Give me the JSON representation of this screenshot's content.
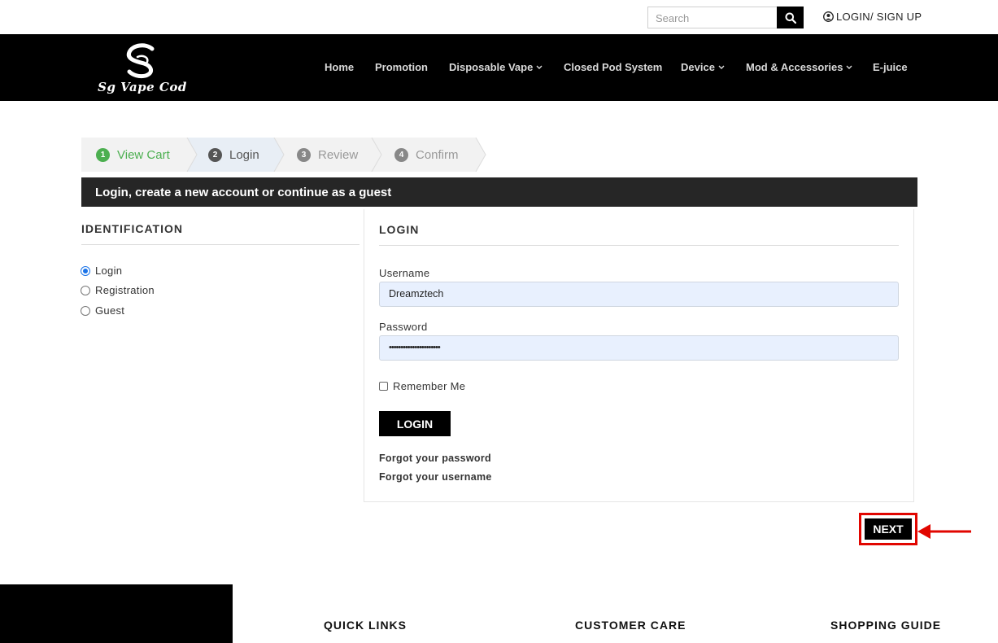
{
  "topbar": {
    "search_placeholder": "Search",
    "login_label": "LOGIN/ SIGN UP"
  },
  "header": {
    "logo_text": "Sg Vape Cod",
    "nav": [
      {
        "label": "Home",
        "dropdown": false
      },
      {
        "label": "Promotion",
        "dropdown": false
      },
      {
        "label": "Disposable Vape",
        "dropdown": true
      },
      {
        "label": "Closed Pod System",
        "dropdown": false
      },
      {
        "label": "Device",
        "dropdown": true
      },
      {
        "label": "Mod & Accessories",
        "dropdown": true
      },
      {
        "label": "E-juice",
        "dropdown": false
      }
    ]
  },
  "steps": [
    {
      "num": "1",
      "label": "View Cart",
      "state": "done",
      "color": "#4caf50"
    },
    {
      "num": "2",
      "label": "Login",
      "state": "active",
      "color": "#555555"
    },
    {
      "num": "3",
      "label": "Review",
      "state": "pending",
      "color": "#888888"
    },
    {
      "num": "4",
      "label": "Confirm",
      "state": "pending",
      "color": "#888888"
    }
  ],
  "title_bar": "Login, create a new account or continue as a guest",
  "identification": {
    "title": "IDENTIFICATION",
    "options": [
      {
        "label": "Login",
        "checked": true
      },
      {
        "label": "Registration",
        "checked": false
      },
      {
        "label": "Guest",
        "checked": false
      }
    ]
  },
  "login": {
    "title": "LOGIN",
    "username_label": "Username",
    "username_value": "Dreamztech",
    "password_label": "Password",
    "password_value": "••••••••••••••••••••••",
    "remember_label": "Remember Me",
    "button_label": "LOGIN",
    "forgot_password": "Forgot your password",
    "forgot_username": "Forgot your username"
  },
  "next_label": "NEXT",
  "footer": {
    "titles": [
      "QUICK LINKS",
      "CUSTOMER CARE",
      "SHOPPING GUIDE"
    ]
  },
  "colors": {
    "accent_red": "#e10600",
    "header_bg": "#000000",
    "titlebar_bg": "#262626",
    "input_bg": "#e8f0fe"
  }
}
